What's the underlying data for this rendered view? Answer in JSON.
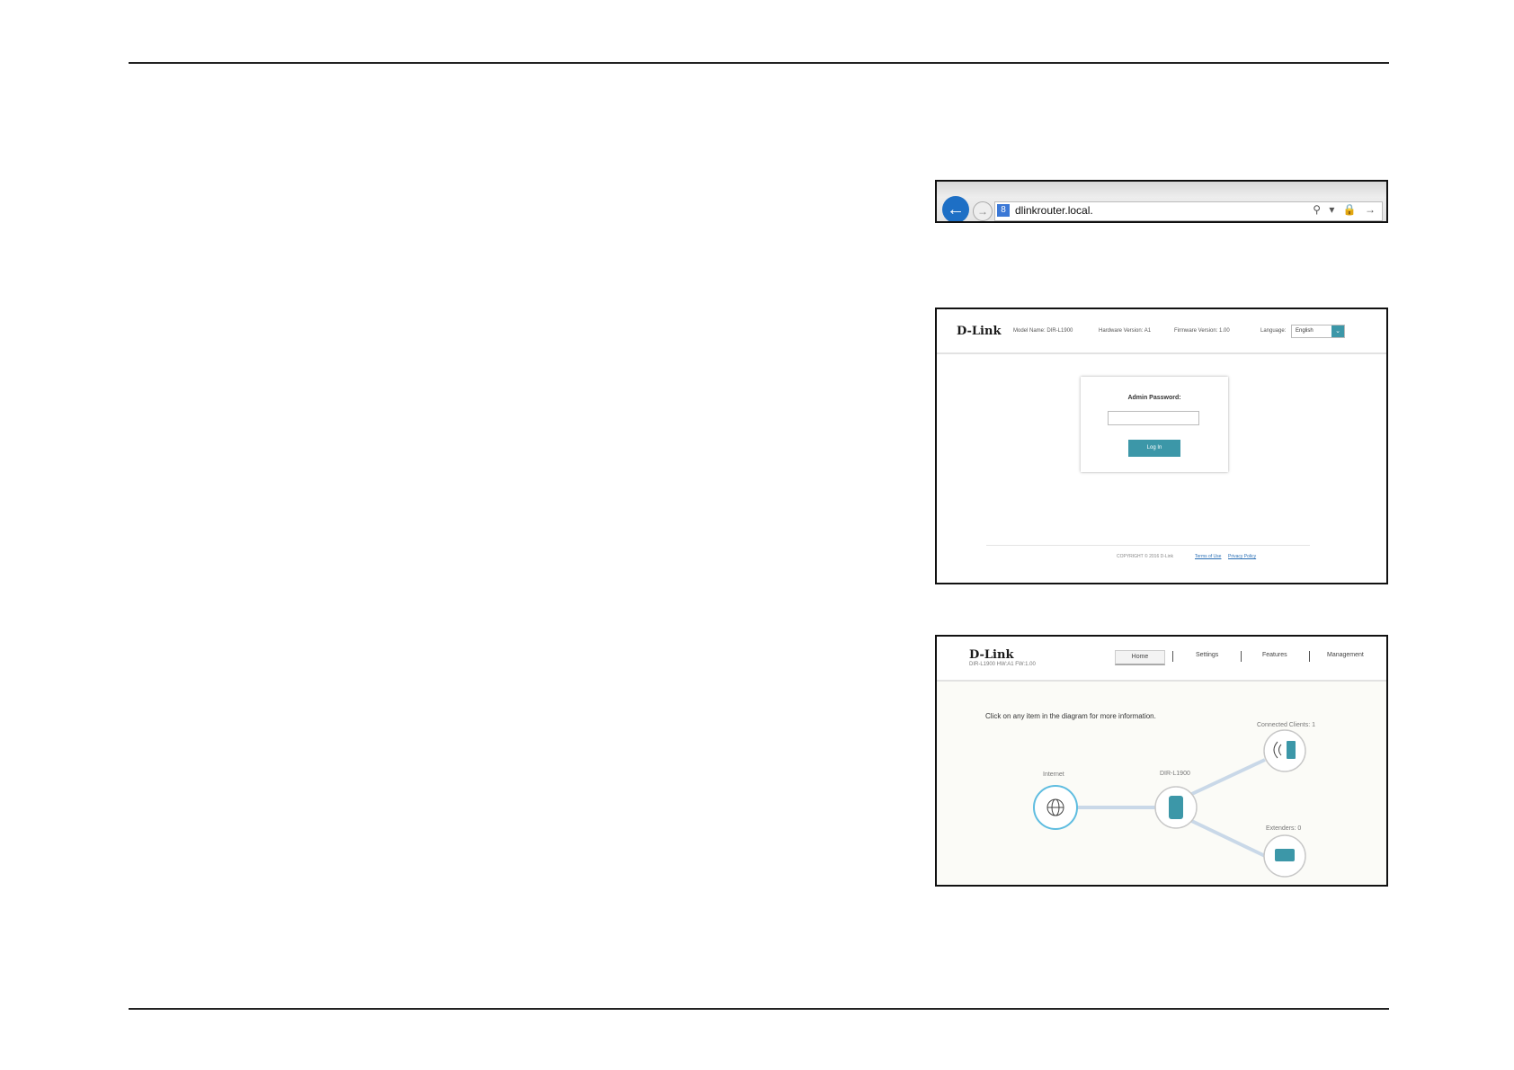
{
  "browser": {
    "url": "dlinkrouter.local.",
    "back_icon": "←",
    "forward_icon": "→",
    "favicon": "8",
    "tools": "⚲ ▾ 🔒 →"
  },
  "login_page": {
    "logo": "D-Link",
    "model_name": "Model Name: DIR-L1900",
    "hardware_version": "Hardware Version: A1",
    "firmware_version": "Firmware Version: 1.00",
    "language_label": "Language:",
    "language_value": "English",
    "admin_password_label": "Admin Password:",
    "login_button": "Log In",
    "copyright": "COPYRIGHT © 2016 D-Link",
    "terms_link": "Terms of Use",
    "privacy_link": "Privacy Policy"
  },
  "home_page": {
    "logo": "D-Link",
    "model_line": "DIR-L1900 HW:A1 FW:1.00",
    "nav": [
      "Home",
      "Settings",
      "Features",
      "Management"
    ],
    "instruction": "Click on any item in the diagram for more information.",
    "nodes": {
      "internet": "Internet",
      "router": "DIR-L1900",
      "clients": "Connected Clients: 1",
      "extenders": "Extenders: 0"
    }
  },
  "colors": {
    "accent": "#3c97a8",
    "browser_back": "#1d6fc5",
    "link": "#2a6fb5"
  }
}
